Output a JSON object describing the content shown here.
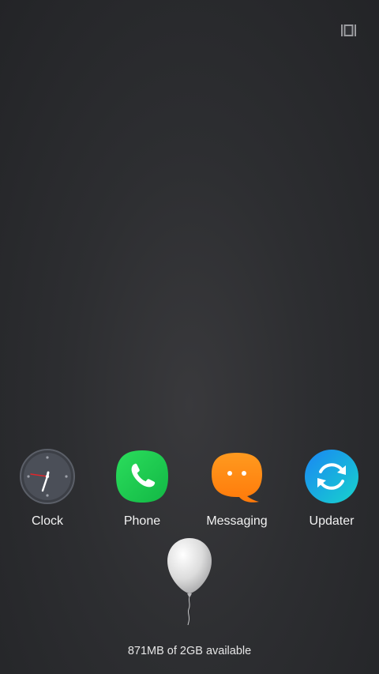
{
  "header": {
    "recents_icon": "multi-window-icon"
  },
  "apps": [
    {
      "label": "Clock",
      "icon": "clock-icon",
      "color": "#4a4d55"
    },
    {
      "label": "Phone",
      "icon": "phone-icon",
      "color": "#1ec94f"
    },
    {
      "label": "Messaging",
      "icon": "message-bubble-icon",
      "color": "#ff8a14"
    },
    {
      "label": "Updater",
      "icon": "sync-icon",
      "color": "#1aa6f0"
    }
  ],
  "memory": {
    "icon": "balloon-icon",
    "text": "871MB of 2GB available"
  }
}
